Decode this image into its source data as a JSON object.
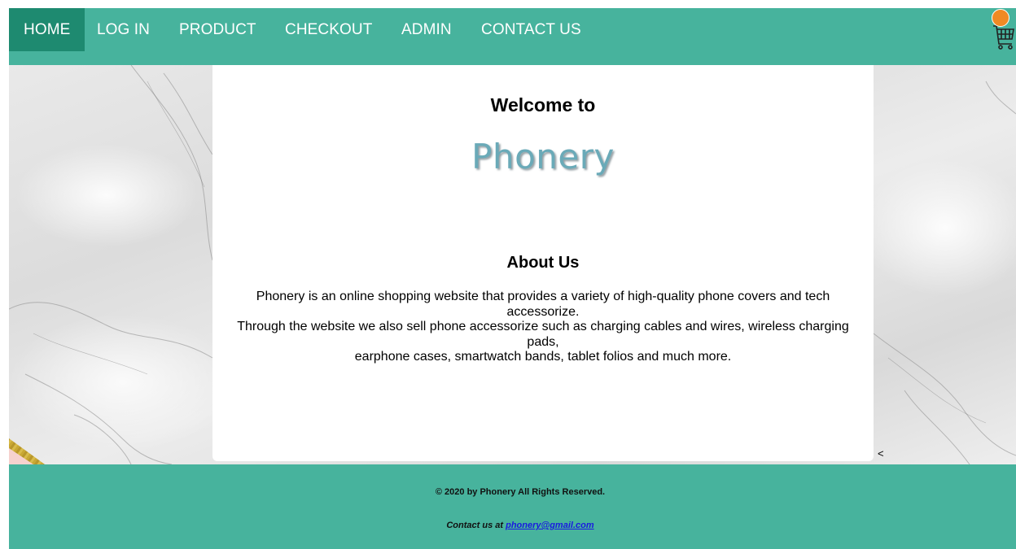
{
  "nav": {
    "items": [
      {
        "label": "HOME",
        "active": true
      },
      {
        "label": "LOG IN"
      },
      {
        "label": "PRODUCT"
      },
      {
        "label": "CHECKOUT"
      },
      {
        "label": "ADMIN"
      },
      {
        "label": "CONTACT US"
      }
    ],
    "cart_icon": "shopping-cart-icon",
    "cart_badge_color": "#f08a24"
  },
  "hero": {
    "welcome": "Welcome to",
    "logo_text": "Phonery"
  },
  "about": {
    "title": "About Us",
    "lines": [
      "Phonery is an online shopping website that provides a variety of high-quality phone covers and tech accessorize.",
      "Through the website we also sell phone accessorize such as charging cables and wires, wireless charging pads,",
      "earphone cases, smartwatch bands, tablet folios and much more."
    ]
  },
  "scroll_arrow": "<",
  "footer": {
    "copyright": "© 2020 by Phonery All Rights Reserved.",
    "contact_prefix": "Contact us at ",
    "contact_email": "phonery@gmail.com"
  },
  "colors": {
    "nav_bg": "#47b39d",
    "nav_active_bg": "#1e8a70",
    "logo": "#6aaab8",
    "footer_bg": "#47b39d"
  }
}
